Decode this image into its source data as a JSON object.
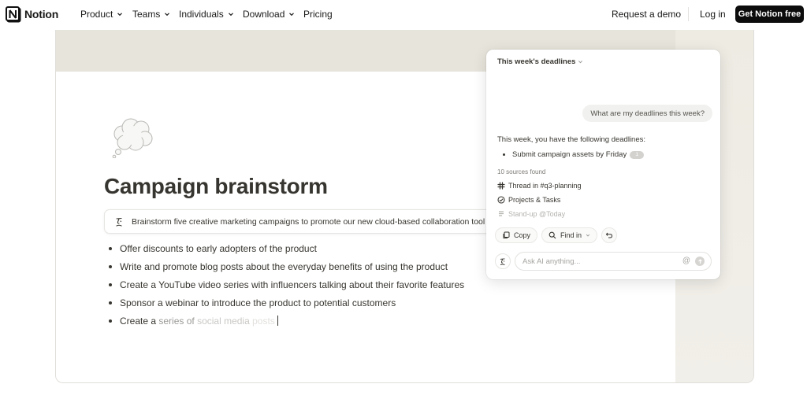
{
  "nav": {
    "brand": "Notion",
    "items": [
      {
        "label": "Product",
        "has_menu": true
      },
      {
        "label": "Teams",
        "has_menu": true
      },
      {
        "label": "Individuals",
        "has_menu": true
      },
      {
        "label": "Download",
        "has_menu": true
      },
      {
        "label": "Pricing",
        "has_menu": false
      }
    ],
    "request_demo": "Request a demo",
    "login": "Log in",
    "cta": "Get Notion free"
  },
  "doc": {
    "icon": "thought-bubble-icon",
    "title": "Campaign brainstorm",
    "prompt_icon": "ai-face-icon",
    "prompt": "Brainstorm five creative marketing campaigns to promote our new cloud-based collaboration tool",
    "bullets": [
      "Offer discounts to early adopters of the product",
      "Write and promote blog posts about the everyday benefits of using the product",
      "Create a YouTube video series with influencers talking about their favorite features",
      "Sponsor a webinar to introduce the product to potential customers"
    ],
    "typing_line": {
      "part1": "Create a",
      "part2": "series of",
      "part3": "social media",
      "part4": "posts"
    }
  },
  "ai_panel": {
    "title": "This week's deadlines",
    "user_question": "What are my deadlines this week?",
    "answer_intro": "This week, you have the following deadlines:",
    "answer_item": "Submit campaign assets by Friday",
    "citation": "1",
    "sources_found": "10 sources found",
    "sources": [
      {
        "icon": "slack-icon",
        "label": "Thread in #q3-planning"
      },
      {
        "icon": "check-circle-icon",
        "label": "Projects & Tasks"
      },
      {
        "icon": "document-icon",
        "label": "Stand-up @Today"
      }
    ],
    "actions": {
      "copy": "Copy",
      "find_in": "Find in"
    },
    "ask_placeholder": "Ask AI anything..."
  },
  "colors": {
    "cta_bg": "#0c0c0c",
    "card_banner": "#e7e4db",
    "text": "#37352f"
  }
}
